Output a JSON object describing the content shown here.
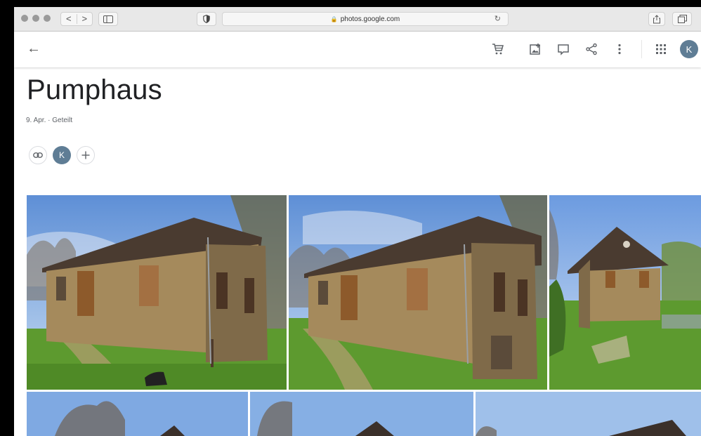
{
  "browser": {
    "url": "photos.google.com",
    "back_label": "<",
    "forward_label": ">"
  },
  "toolbar": {
    "back_icon": "arrow-left-icon",
    "actions": [
      "cart-icon",
      "add-to-album-icon",
      "slideshow-icon",
      "share-icon",
      "more-vert-icon",
      "apps-grid-icon"
    ],
    "avatar_letter": "K"
  },
  "album": {
    "title": "Pumphaus",
    "meta": "9. Apr. · Geteilt",
    "owner_letter": "K"
  },
  "colors": {
    "sky": "#8fb6e8",
    "brick": "#a58a5c",
    "roof": "#4a3b30",
    "grass": "#5b9a2e",
    "avatar": "#5f7d95"
  }
}
